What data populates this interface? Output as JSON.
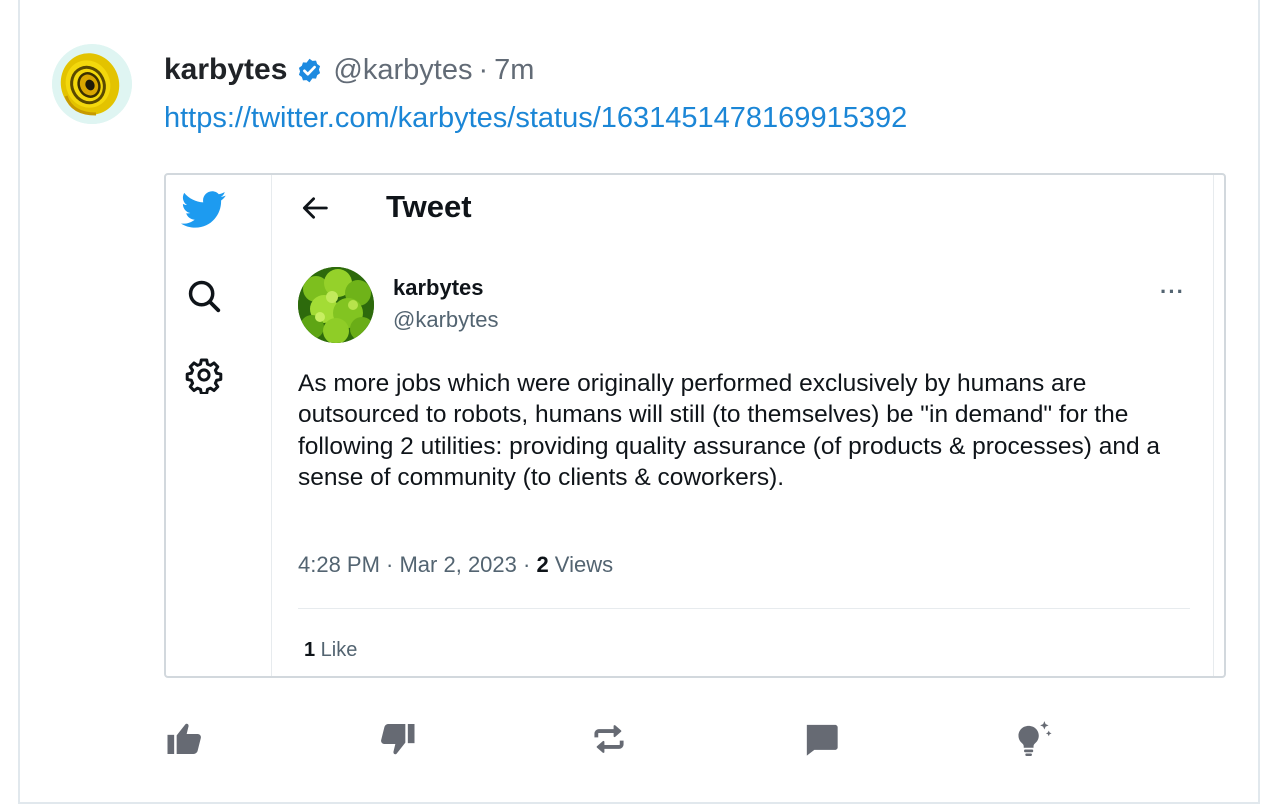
{
  "post": {
    "author_name": "karbytes",
    "handle": "@karbytes",
    "separator": "·",
    "time": "7m",
    "link_text": "https://twitter.com/karbytes/status/1631451478169915392"
  },
  "embed": {
    "title": "Tweet",
    "author_name": "karbytes",
    "author_handle": "@karbytes",
    "more": "···",
    "body": "As more jobs which were originally performed exclusively by humans are outsourced to robots, humans will still (to themselves) be \"in demand\" for the following 2 utilities: providing quality assurance (of products & processes) and a sense of community (to clients & coworkers).",
    "timestamp": "4:28 PM · Mar 2, 2023 · ",
    "views_count": "2",
    "views_label": " Views",
    "likes_count": "1",
    "likes_label": " Like",
    "sidebar_icons": [
      "twitter-bird-icon",
      "search-icon",
      "gear-icon"
    ]
  },
  "actions": [
    {
      "name": "like-icon"
    },
    {
      "name": "dislike-icon"
    },
    {
      "name": "repost-icon"
    },
    {
      "name": "comment-icon"
    },
    {
      "name": "insight-icon"
    }
  ],
  "colors": {
    "link": "#1b86d6",
    "verified": "#1d8ae0",
    "twitter_blue": "#1d9bf0",
    "action_icon": "#666a73"
  }
}
